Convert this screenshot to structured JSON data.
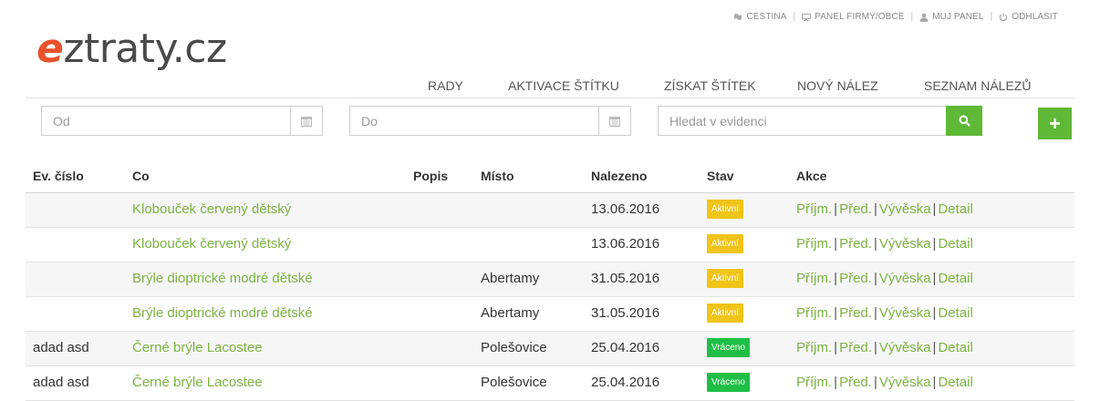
{
  "topbar": {
    "language": "CESTINA",
    "company_panel": "PANEL FIRMY/OBCE",
    "my_panel": "MUJ PANEL",
    "logout": "ODHLASIT"
  },
  "logo": {
    "first": "e",
    "rest": "ztraty.cz"
  },
  "nav": {
    "rady": "RADY",
    "aktivace": "AKTIVACE ŠTÍTKU",
    "ziskat": "ZÍSKAT ŠTÍTEK",
    "novy": "NOVÝ NÁLEZ",
    "seznam": "SEZNAM NÁLEZŮ"
  },
  "filters": {
    "from_placeholder": "Od",
    "to_placeholder": "Do",
    "search_placeholder": "Hledat v evidenci"
  },
  "table": {
    "headers": {
      "ev": "Ev. číslo",
      "co": "Co",
      "popis": "Popis",
      "misto": "Místo",
      "nalezeno": "Nalezeno",
      "stav": "Stav",
      "akce": "Akce"
    },
    "rows": [
      {
        "ev": "",
        "co": "Klobouček červený dětský",
        "popis": "",
        "misto": "",
        "nalezeno": "13.06.2016",
        "stav": "Aktivní",
        "stav_color": "#f0c419"
      },
      {
        "ev": "",
        "co": "Klobouček červený dětský",
        "popis": "",
        "misto": "",
        "nalezeno": "13.06.2016",
        "stav": "Aktivní",
        "stav_color": "#f0c419"
      },
      {
        "ev": "",
        "co": "Brýle dioptrické modré dětské",
        "popis": "",
        "misto": "Abertamy",
        "nalezeno": "31.05.2016",
        "stav": "Aktivní",
        "stav_color": "#f0c419"
      },
      {
        "ev": "",
        "co": "Brýle dioptrické modré dětské",
        "popis": "",
        "misto": "Abertamy",
        "nalezeno": "31.05.2016",
        "stav": "Aktivní",
        "stav_color": "#f0c419"
      },
      {
        "ev": "adad asd",
        "co": "Černé brýle Lacostee",
        "popis": "",
        "misto": "Polešovice",
        "nalezeno": "25.04.2016",
        "stav": "Vráceno",
        "stav_color": "#1fbf46"
      },
      {
        "ev": "adad asd",
        "co": "Černé brýle Lacostee",
        "popis": "",
        "misto": "Polešovice",
        "nalezeno": "25.04.2016",
        "stav": "Vráceno",
        "stav_color": "#1fbf46"
      }
    ],
    "actions": {
      "prijm": "Příjm.",
      "pred": "Před.",
      "vyveska": "Vývěska",
      "detail": "Detail",
      "separator": "|"
    }
  },
  "colors": {
    "accent_green": "#5fb836",
    "link_green": "#7cb342",
    "logo_orange": "#e8522b",
    "badge_active": "#f0c419",
    "badge_returned": "#1fbf46"
  }
}
